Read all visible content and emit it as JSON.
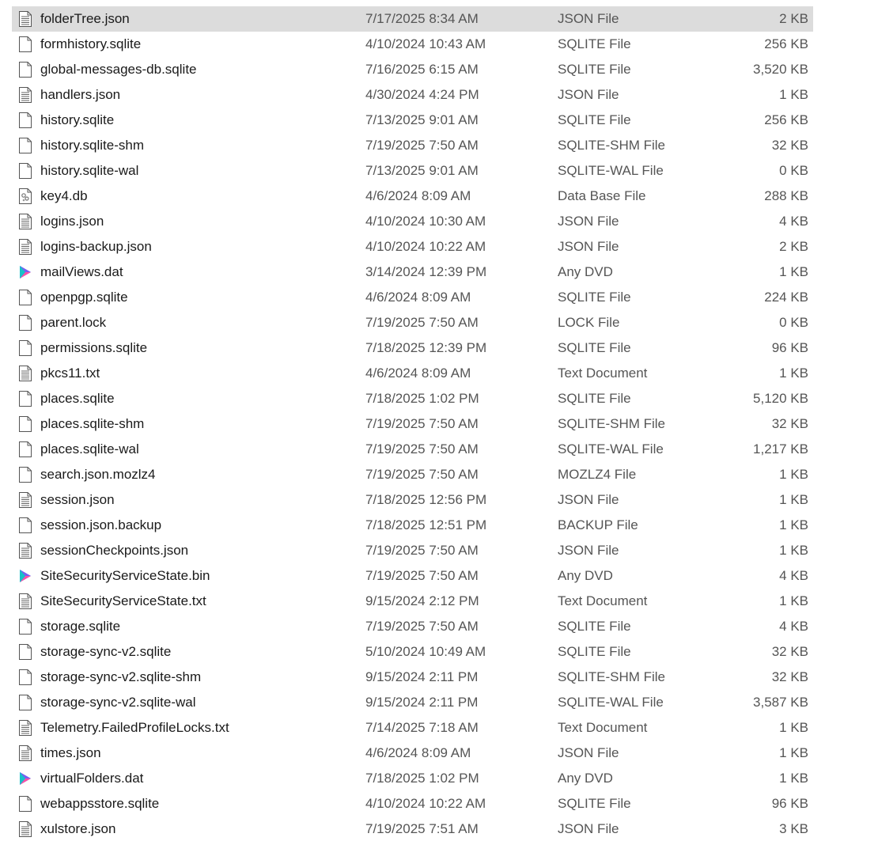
{
  "files": [
    {
      "name": "folderTree.json",
      "date": "7/17/2025 8:34 AM",
      "type": "JSON File",
      "size": "2 KB",
      "icon": "lined-doc-icon",
      "selected": true
    },
    {
      "name": "formhistory.sqlite",
      "date": "4/10/2024 10:43 AM",
      "type": "SQLITE File",
      "size": "256 KB",
      "icon": "blank-doc-icon"
    },
    {
      "name": "global-messages-db.sqlite",
      "date": "7/16/2025 6:15 AM",
      "type": "SQLITE File",
      "size": "3,520 KB",
      "icon": "blank-doc-icon"
    },
    {
      "name": "handlers.json",
      "date": "4/30/2024 4:24 PM",
      "type": "JSON File",
      "size": "1 KB",
      "icon": "lined-doc-icon"
    },
    {
      "name": "history.sqlite",
      "date": "7/13/2025 9:01 AM",
      "type": "SQLITE File",
      "size": "256 KB",
      "icon": "blank-doc-icon"
    },
    {
      "name": "history.sqlite-shm",
      "date": "7/19/2025 7:50 AM",
      "type": "SQLITE-SHM File",
      "size": "32 KB",
      "icon": "blank-doc-icon"
    },
    {
      "name": "history.sqlite-wal",
      "date": "7/13/2025 9:01 AM",
      "type": "SQLITE-WAL File",
      "size": "0 KB",
      "icon": "blank-doc-icon"
    },
    {
      "name": "key4.db",
      "date": "4/6/2024 8:09 AM",
      "type": "Data Base File",
      "size": "288 KB",
      "icon": "database-file-icon"
    },
    {
      "name": "logins.json",
      "date": "4/10/2024 10:30 AM",
      "type": "JSON File",
      "size": "4 KB",
      "icon": "lined-doc-icon"
    },
    {
      "name": "logins-backup.json",
      "date": "4/10/2024 10:22 AM",
      "type": "JSON File",
      "size": "2 KB",
      "icon": "lined-doc-icon"
    },
    {
      "name": "mailViews.dat",
      "date": "3/14/2024 12:39 PM",
      "type": "Any DVD",
      "size": "1 KB",
      "icon": "anydvd-icon"
    },
    {
      "name": "openpgp.sqlite",
      "date": "4/6/2024 8:09 AM",
      "type": "SQLITE File",
      "size": "224 KB",
      "icon": "blank-doc-icon"
    },
    {
      "name": "parent.lock",
      "date": "7/19/2025 7:50 AM",
      "type": "LOCK File",
      "size": "0 KB",
      "icon": "blank-doc-icon"
    },
    {
      "name": "permissions.sqlite",
      "date": "7/18/2025 12:39 PM",
      "type": "SQLITE File",
      "size": "96 KB",
      "icon": "blank-doc-icon"
    },
    {
      "name": "pkcs11.txt",
      "date": "4/6/2024 8:09 AM",
      "type": "Text Document",
      "size": "1 KB",
      "icon": "lined-doc-icon"
    },
    {
      "name": "places.sqlite",
      "date": "7/18/2025 1:02 PM",
      "type": "SQLITE File",
      "size": "5,120 KB",
      "icon": "blank-doc-icon"
    },
    {
      "name": "places.sqlite-shm",
      "date": "7/19/2025 7:50 AM",
      "type": "SQLITE-SHM File",
      "size": "32 KB",
      "icon": "blank-doc-icon"
    },
    {
      "name": "places.sqlite-wal",
      "date": "7/19/2025 7:50 AM",
      "type": "SQLITE-WAL File",
      "size": "1,217 KB",
      "icon": "blank-doc-icon"
    },
    {
      "name": "search.json.mozlz4",
      "date": "7/19/2025 7:50 AM",
      "type": "MOZLZ4 File",
      "size": "1 KB",
      "icon": "blank-doc-icon"
    },
    {
      "name": "session.json",
      "date": "7/18/2025 12:56 PM",
      "type": "JSON File",
      "size": "1 KB",
      "icon": "lined-doc-icon"
    },
    {
      "name": "session.json.backup",
      "date": "7/18/2025 12:51 PM",
      "type": "BACKUP File",
      "size": "1 KB",
      "icon": "blank-doc-icon"
    },
    {
      "name": "sessionCheckpoints.json",
      "date": "7/19/2025 7:50 AM",
      "type": "JSON File",
      "size": "1 KB",
      "icon": "lined-doc-icon"
    },
    {
      "name": "SiteSecurityServiceState.bin",
      "date": "7/19/2025 7:50 AM",
      "type": "Any DVD",
      "size": "4 KB",
      "icon": "anydvd-icon"
    },
    {
      "name": "SiteSecurityServiceState.txt",
      "date": "9/15/2024 2:12 PM",
      "type": "Text Document",
      "size": "1 KB",
      "icon": "lined-doc-icon"
    },
    {
      "name": "storage.sqlite",
      "date": "7/19/2025 7:50 AM",
      "type": "SQLITE File",
      "size": "4 KB",
      "icon": "blank-doc-icon"
    },
    {
      "name": "storage-sync-v2.sqlite",
      "date": "5/10/2024 10:49 AM",
      "type": "SQLITE File",
      "size": "32 KB",
      "icon": "blank-doc-icon"
    },
    {
      "name": "storage-sync-v2.sqlite-shm",
      "date": "9/15/2024 2:11 PM",
      "type": "SQLITE-SHM File",
      "size": "32 KB",
      "icon": "blank-doc-icon"
    },
    {
      "name": "storage-sync-v2.sqlite-wal",
      "date": "9/15/2024 2:11 PM",
      "type": "SQLITE-WAL File",
      "size": "3,587 KB",
      "icon": "blank-doc-icon"
    },
    {
      "name": "Telemetry.FailedProfileLocks.txt",
      "date": "7/14/2025 7:18 AM",
      "type": "Text Document",
      "size": "1 KB",
      "icon": "lined-doc-icon"
    },
    {
      "name": "times.json",
      "date": "4/6/2024 8:09 AM",
      "type": "JSON File",
      "size": "1 KB",
      "icon": "lined-doc-icon"
    },
    {
      "name": "virtualFolders.dat",
      "date": "7/18/2025 1:02 PM",
      "type": "Any DVD",
      "size": "1 KB",
      "icon": "anydvd-icon"
    },
    {
      "name": "webappsstore.sqlite",
      "date": "4/10/2024 10:22 AM",
      "type": "SQLITE File",
      "size": "96 KB",
      "icon": "blank-doc-icon"
    },
    {
      "name": "xulstore.json",
      "date": "7/19/2025 7:51 AM",
      "type": "JSON File",
      "size": "3 KB",
      "icon": "lined-doc-icon"
    }
  ],
  "colors": {
    "selection": "#dcdcdc",
    "text": "#1a1a1a",
    "secondary_text": "#555555"
  }
}
